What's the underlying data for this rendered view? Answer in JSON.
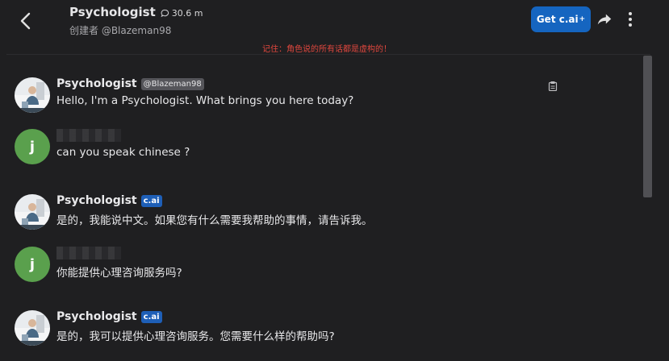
{
  "header": {
    "title": "Psychologist",
    "chat_count": "30.6 m",
    "creator": "创建者 @Blazeman98",
    "get_button_label": "Get c.ai",
    "get_button_sup": "+",
    "disclaimer": "记住：角色说的所有话都是虚构的！"
  },
  "messages": [
    {
      "sender": "Psychologist",
      "tag": "@Blazeman98",
      "text": "Hello, I'm a Psychologist. What brings you here today?"
    },
    {
      "sender": "j",
      "text": "can you speak chinese ?"
    },
    {
      "sender": "Psychologist",
      "tag": "c.ai",
      "text": "是的，我能说中文。如果您有什么需要我帮助的事情，请告诉我。"
    },
    {
      "sender": "j",
      "text": "你能提供心理咨询服务吗?"
    },
    {
      "sender": "Psychologist",
      "tag": "c.ai",
      "text": "是的，我可以提供心理咨询服务。您需要什么样的帮助吗?"
    }
  ],
  "colors": {
    "background": "#1f1f21",
    "accent": "#1565c0",
    "user_avatar": "#5aa04d",
    "disclaimer": "#e0473e"
  },
  "icons": [
    "back-arrow-icon",
    "chat-bubble-icon",
    "share-icon",
    "more-vertical-icon",
    "copy-icon"
  ]
}
